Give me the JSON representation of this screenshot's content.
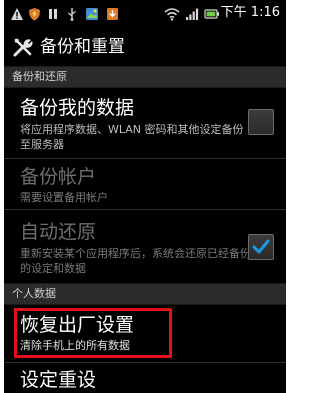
{
  "status_bar": {
    "icons": [
      "warning-icon",
      "shield-icon",
      "pause-icon",
      "usb-icon",
      "photo-icon",
      "download-icon",
      "wifi-icon",
      "signal-icon",
      "battery-icon"
    ],
    "time": "下午 1:16"
  },
  "action_bar": {
    "icon": "tools-icon",
    "title": "备份和重置"
  },
  "sections": {
    "backup_restore_header": "备份和还原",
    "personal_data_header": "个人数据"
  },
  "settings": {
    "backup_my_data": {
      "title": "备份我的数据",
      "summary": "将应用程序数据、WLAN 密码和其他设定备份至服务器",
      "checked": false
    },
    "backup_account": {
      "title": "备份帐户",
      "summary": "需要设置备用帐户",
      "enabled": false
    },
    "auto_restore": {
      "title": "自动还原",
      "summary": "重新安装某个应用程序后，系统会还原已经备份的设定和数据",
      "checked": true,
      "enabled": false
    },
    "factory_reset": {
      "title": "恢复出厂设置",
      "summary": "清除手机上的所有数据"
    },
    "settings_reset": {
      "title": "设定重设"
    }
  },
  "colors": {
    "background": "#000000",
    "section_header_bg": "#2b2b2b",
    "highlight_border": "#e3101a",
    "checkmark": "#1a9be0"
  }
}
